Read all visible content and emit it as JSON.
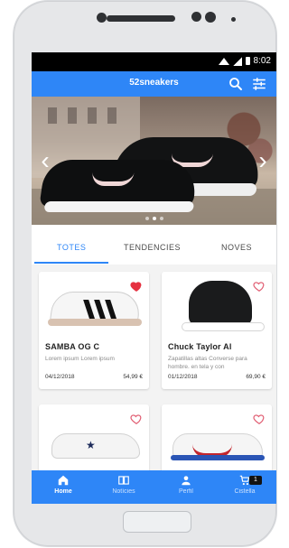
{
  "status": {
    "time": "8:02"
  },
  "app": {
    "title": "52sneakers"
  },
  "icons": {
    "search": "search-icon",
    "filter": "filter-icon",
    "prev": "chevron-left-icon",
    "next": "chevron-right-icon"
  },
  "hero": {
    "slides": 3,
    "active_index": 1
  },
  "tabs": [
    {
      "label": "TOTES",
      "active": true
    },
    {
      "label": "TENDENCIES",
      "active": false
    },
    {
      "label": "NOVES",
      "active": false
    }
  ],
  "products": [
    {
      "name": "SAMBA OG C",
      "desc": "Lorem ipsum Lorem ipsum",
      "date": "04/12/2018",
      "price": "54,99 €",
      "favorite": true
    },
    {
      "name": "Chuck Taylor Al",
      "desc": "Zapatillas altas Converse para hombre. en tela y con",
      "date": "01/12/2018",
      "price": "69,90 €",
      "favorite": false
    },
    {
      "name": "",
      "desc": "",
      "date": "",
      "price": "",
      "favorite": false
    },
    {
      "name": "",
      "desc": "",
      "date": "",
      "price": "",
      "favorite": false
    }
  ],
  "nav": [
    {
      "label": "Home",
      "icon": "home-icon",
      "active": true
    },
    {
      "label": "Notícies",
      "icon": "book-icon",
      "active": false
    },
    {
      "label": "Perfil",
      "icon": "person-icon",
      "active": false
    },
    {
      "label": "Cistella",
      "icon": "cart-icon",
      "active": false,
      "badge": "1"
    }
  ],
  "colors": {
    "primary": "#2e86f7",
    "heart": "#e53140"
  }
}
